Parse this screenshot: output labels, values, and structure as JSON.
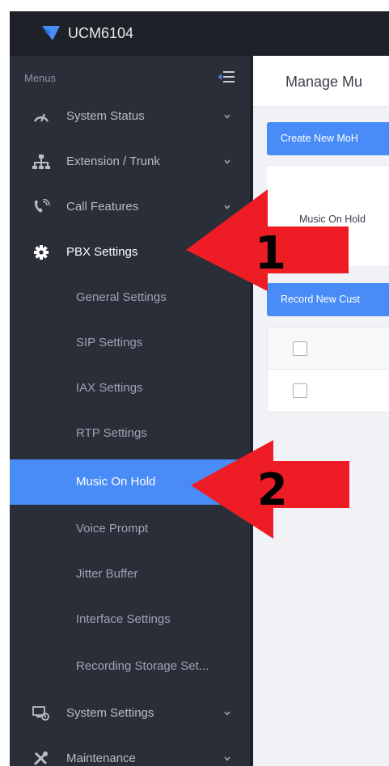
{
  "app": {
    "title": "UCM6104"
  },
  "sidebar": {
    "menus_label": "Menus",
    "items": [
      {
        "label": "System Status",
        "icon": "gauge-icon"
      },
      {
        "label": "Extension / Trunk",
        "icon": "network-icon"
      },
      {
        "label": "Call Features",
        "icon": "phone-icon"
      },
      {
        "label": "PBX Settings",
        "icon": "gear-icon"
      },
      {
        "label": "System Settings",
        "icon": "system-settings-icon"
      },
      {
        "label": "Maintenance",
        "icon": "tools-icon"
      }
    ],
    "pbx_subitems": [
      {
        "label": "General Settings"
      },
      {
        "label": "SIP Settings"
      },
      {
        "label": "IAX Settings"
      },
      {
        "label": "RTP Settings"
      },
      {
        "label": "Music On Hold"
      },
      {
        "label": "Voice Prompt"
      },
      {
        "label": "Jitter Buffer"
      },
      {
        "label": "Interface Settings"
      },
      {
        "label": "Recording Storage Set..."
      }
    ],
    "active_subitem": "Music On Hold"
  },
  "main": {
    "title": "Manage Mu",
    "create_button": "Create New MoH",
    "moh_label": "Music On Hold",
    "record_button": "Record New Cust"
  },
  "annotations": [
    {
      "label": "1",
      "color": "#ee1c24"
    },
    {
      "label": "2",
      "color": "#ee1c24"
    }
  ],
  "colors": {
    "accent": "#4a8cf7",
    "sidebar_bg": "#2a2e39",
    "topbar_bg": "#1f2128",
    "arrow": "#ee1c24"
  }
}
